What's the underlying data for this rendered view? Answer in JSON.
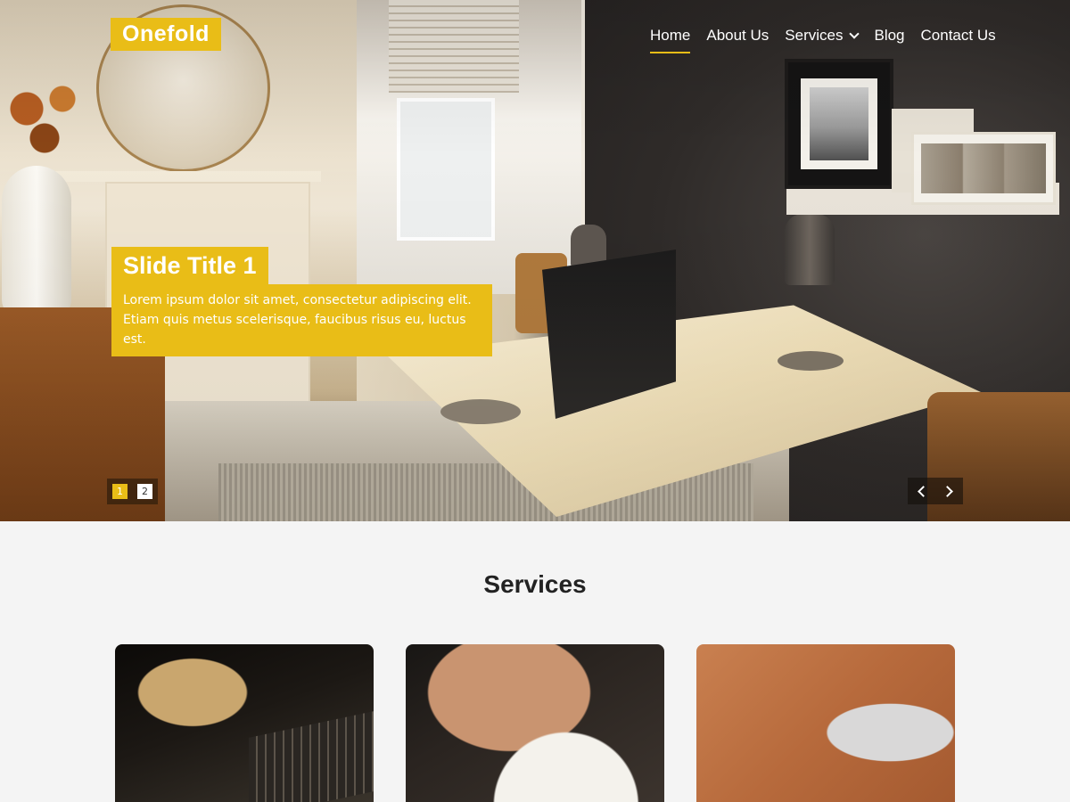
{
  "header": {
    "logo": "Onefold",
    "nav": [
      {
        "label": "Home",
        "active": true
      },
      {
        "label": "About Us",
        "active": false
      },
      {
        "label": "Services",
        "active": false,
        "has_dropdown": true
      },
      {
        "label": "Blog",
        "active": false
      },
      {
        "label": "Contact Us",
        "active": false
      }
    ]
  },
  "slider": {
    "title": "Slide Title 1",
    "text": "Lorem ipsum dolor sit amet, consectetur adipiscing elit. Etiam quis metus scelerisque, faucibus risus eu, luctus est.",
    "pages": [
      "1",
      "2"
    ],
    "current_page": "1",
    "prev_icon": "chevron-left-icon",
    "next_icon": "chevron-right-icon"
  },
  "services": {
    "title": "Services",
    "cards": [
      {
        "image": "music-equipment-photo"
      },
      {
        "image": "embroidery-photo"
      },
      {
        "image": "tattoo-artist-photo"
      }
    ]
  },
  "colors": {
    "accent": "#e9bd17",
    "nav_text": "#ffffff",
    "heading": "#222222",
    "page_bg": "#f4f4f4"
  }
}
